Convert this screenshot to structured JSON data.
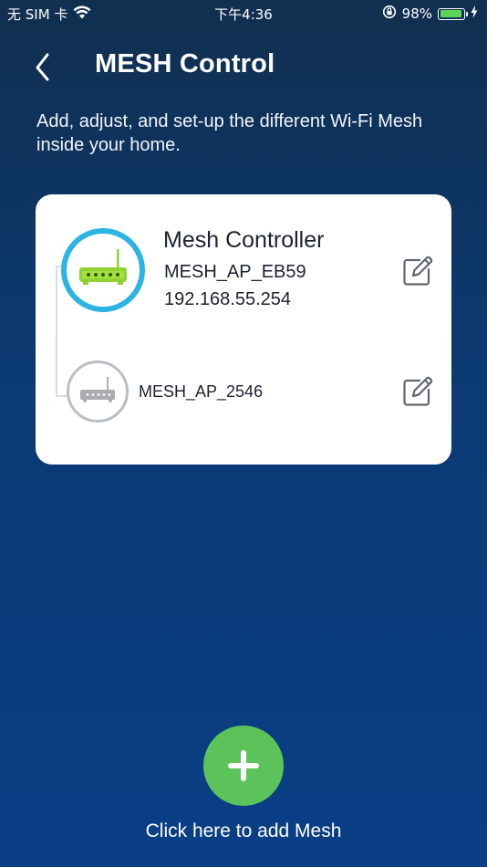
{
  "status_bar": {
    "carrier": "无 SIM 卡",
    "time": "下午4:36",
    "battery_percent_text": "98%",
    "battery_level": 0.98,
    "icons": [
      "wifi-icon",
      "orientation-lock-icon",
      "battery-icon",
      "charging-icon"
    ]
  },
  "header": {
    "title": "MESH Control",
    "back_icon": "chevron-left-icon"
  },
  "description": "Add, adjust, and set-up the different Wi-Fi Mesh inside your home.",
  "devices": [
    {
      "role": "Mesh Controller",
      "ssid": "MESH_AP_EB59",
      "ip": "192.168.55.254",
      "icon": "router-icon",
      "accent_color": "#2cb4e3",
      "router_color": "#8fd332",
      "edit_icon": "edit-icon"
    },
    {
      "ssid": "MESH_AP_2546",
      "icon": "router-icon",
      "accent_color": "#b9bec4",
      "router_color": "#a9adb2",
      "edit_icon": "edit-icon"
    }
  ],
  "add_mesh": {
    "label": "Click here to add Mesh",
    "icon": "plus-icon",
    "color": "#5cc35a"
  }
}
